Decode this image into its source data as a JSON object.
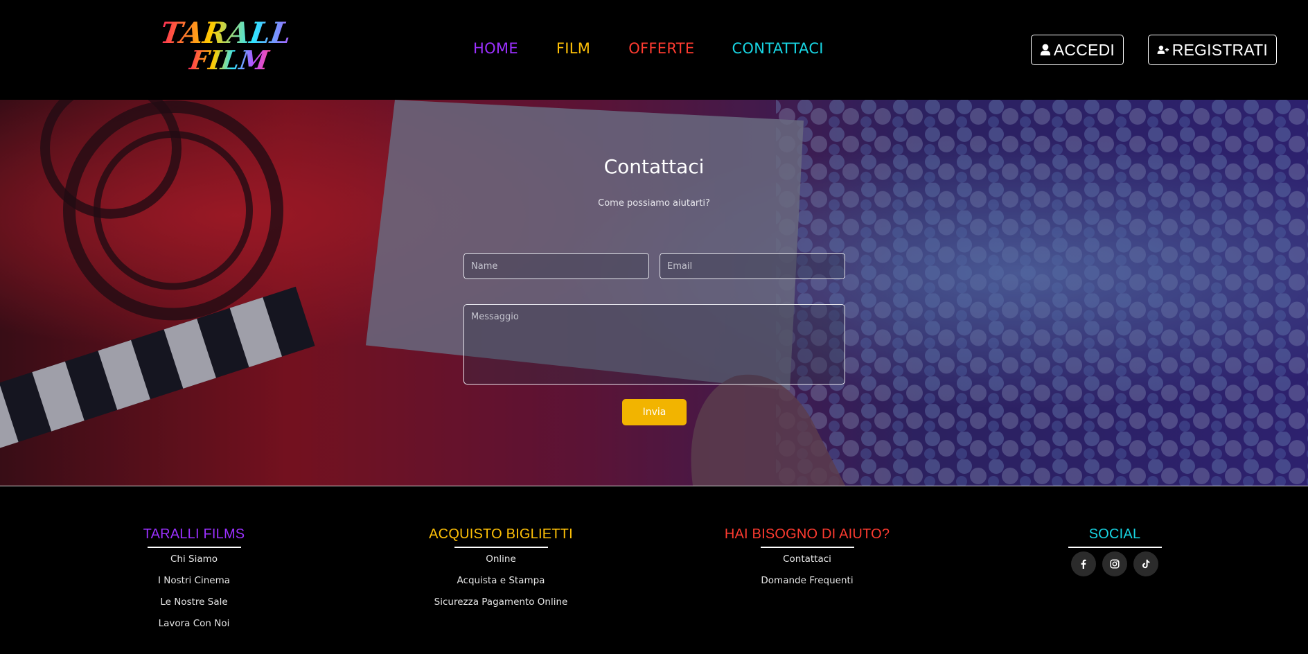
{
  "header": {
    "logo_text_line1": "TARALLI's",
    "logo_text_line2": "FILM",
    "nav": {
      "home": "HOME",
      "film": "FILM",
      "offerte": "OFFERTE",
      "contattaci": "CONTATTACI"
    },
    "accedi_label": "ACCEDI",
    "registrati_label": "REGISTRATI"
  },
  "contact": {
    "title": "Contattaci",
    "subtitle": "Come possiamo aiutarti?",
    "name_placeholder": "Name",
    "email_placeholder": "Email",
    "message_placeholder": "Messaggio",
    "send_label": "Invia"
  },
  "footer": {
    "col1": {
      "title": "TARALLI FILMS",
      "links": [
        "Chi Siamo",
        "I Nostri Cinema",
        "Le Nostre Sale",
        "Lavora Con Noi"
      ]
    },
    "col2": {
      "title": "ACQUISTO BIGLIETTI",
      "links": [
        "Online",
        "Acquista e Stampa",
        "Sicurezza Pagamento Online"
      ]
    },
    "col3": {
      "title": "HAI BISOGNO DI AIUTO?",
      "links": [
        "Contattaci",
        "Domande Frequenti"
      ]
    },
    "col4": {
      "title": "SOCIAL",
      "icons": [
        "facebook-icon",
        "instagram-icon",
        "tiktok-icon"
      ]
    }
  },
  "colors": {
    "purple": "#9b30ff",
    "yellow": "#ffc107",
    "red": "#ff3b30",
    "cyan": "#18d6e4",
    "button_yellow": "#f2b400"
  }
}
